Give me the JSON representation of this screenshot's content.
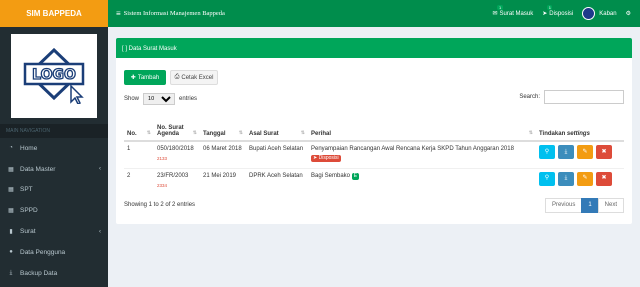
{
  "brand": "SIM BAPPEDA",
  "header": {
    "title": "Sistem Informasi Manajemen Bappeda",
    "surat_masuk": "Surat Masuk",
    "surat_masuk_count": "1",
    "disposisi": "Disposisi",
    "disposisi_count": "1",
    "user": "Kaban"
  },
  "sidebar": {
    "logo_text": "LOGO",
    "nav_header": "MAIN NAVIGATION",
    "items": [
      {
        "label": "Home",
        "icon": "dashboard-icon"
      },
      {
        "label": "Data Master",
        "icon": "table-icon"
      },
      {
        "label": "SPT",
        "icon": "table-icon"
      },
      {
        "label": "SPPD",
        "icon": "table-icon"
      },
      {
        "label": "Surat",
        "icon": "bookmark-icon"
      },
      {
        "label": "Data Pengguna",
        "icon": "user-icon"
      },
      {
        "label": "Backup Data",
        "icon": "download-icon"
      }
    ]
  },
  "main": {
    "box_title": "[ ] Data Surat Masuk",
    "tambah_label": "Tambah",
    "cetak_label": "Cetak Excel",
    "show_label": "Show",
    "entries_value": "10",
    "entries_label": "entries",
    "search_label": "Search:",
    "search_value": "",
    "columns": [
      "No.",
      "No. Surat Agenda",
      "Tanggal",
      "Asal Surat",
      "Perihal",
      "Tindakan settings"
    ],
    "column_no": "No.",
    "column_agenda": "No. Surat Agenda",
    "column_tanggal": "Tanggal",
    "column_asal": "Asal Surat",
    "column_perihal": "Perihal",
    "column_tindakan": "Tindakan",
    "column_tindakan_sub": "settings",
    "rows": [
      {
        "no": "1",
        "agenda": "050/180/2018",
        "agenda_sub": "2133",
        "tanggal": "06 Maret 2018",
        "asal": "Bupati Aceh Selatan",
        "perihal": "Penyampaian Rancangan Awal Rencana Kerja SKPD Tahun Anggaran 2018",
        "badge": "Disposisi"
      },
      {
        "no": "2",
        "agenda": "23/FR/2003",
        "agenda_sub": "2334",
        "tanggal": "21 Mei 2019",
        "asal": "DPRK Aceh Selatan",
        "perihal": "Bagi Sembako",
        "badge": "E"
      }
    ],
    "info": "Showing 1 to 2 of 2 entries",
    "pager": {
      "prev": "Previous",
      "page": "1",
      "next": "Next"
    }
  },
  "colors": {
    "topbar": "#008d4c",
    "brand": "#f39c12",
    "sidebar": "#222d32",
    "accent": "#00a65a"
  }
}
